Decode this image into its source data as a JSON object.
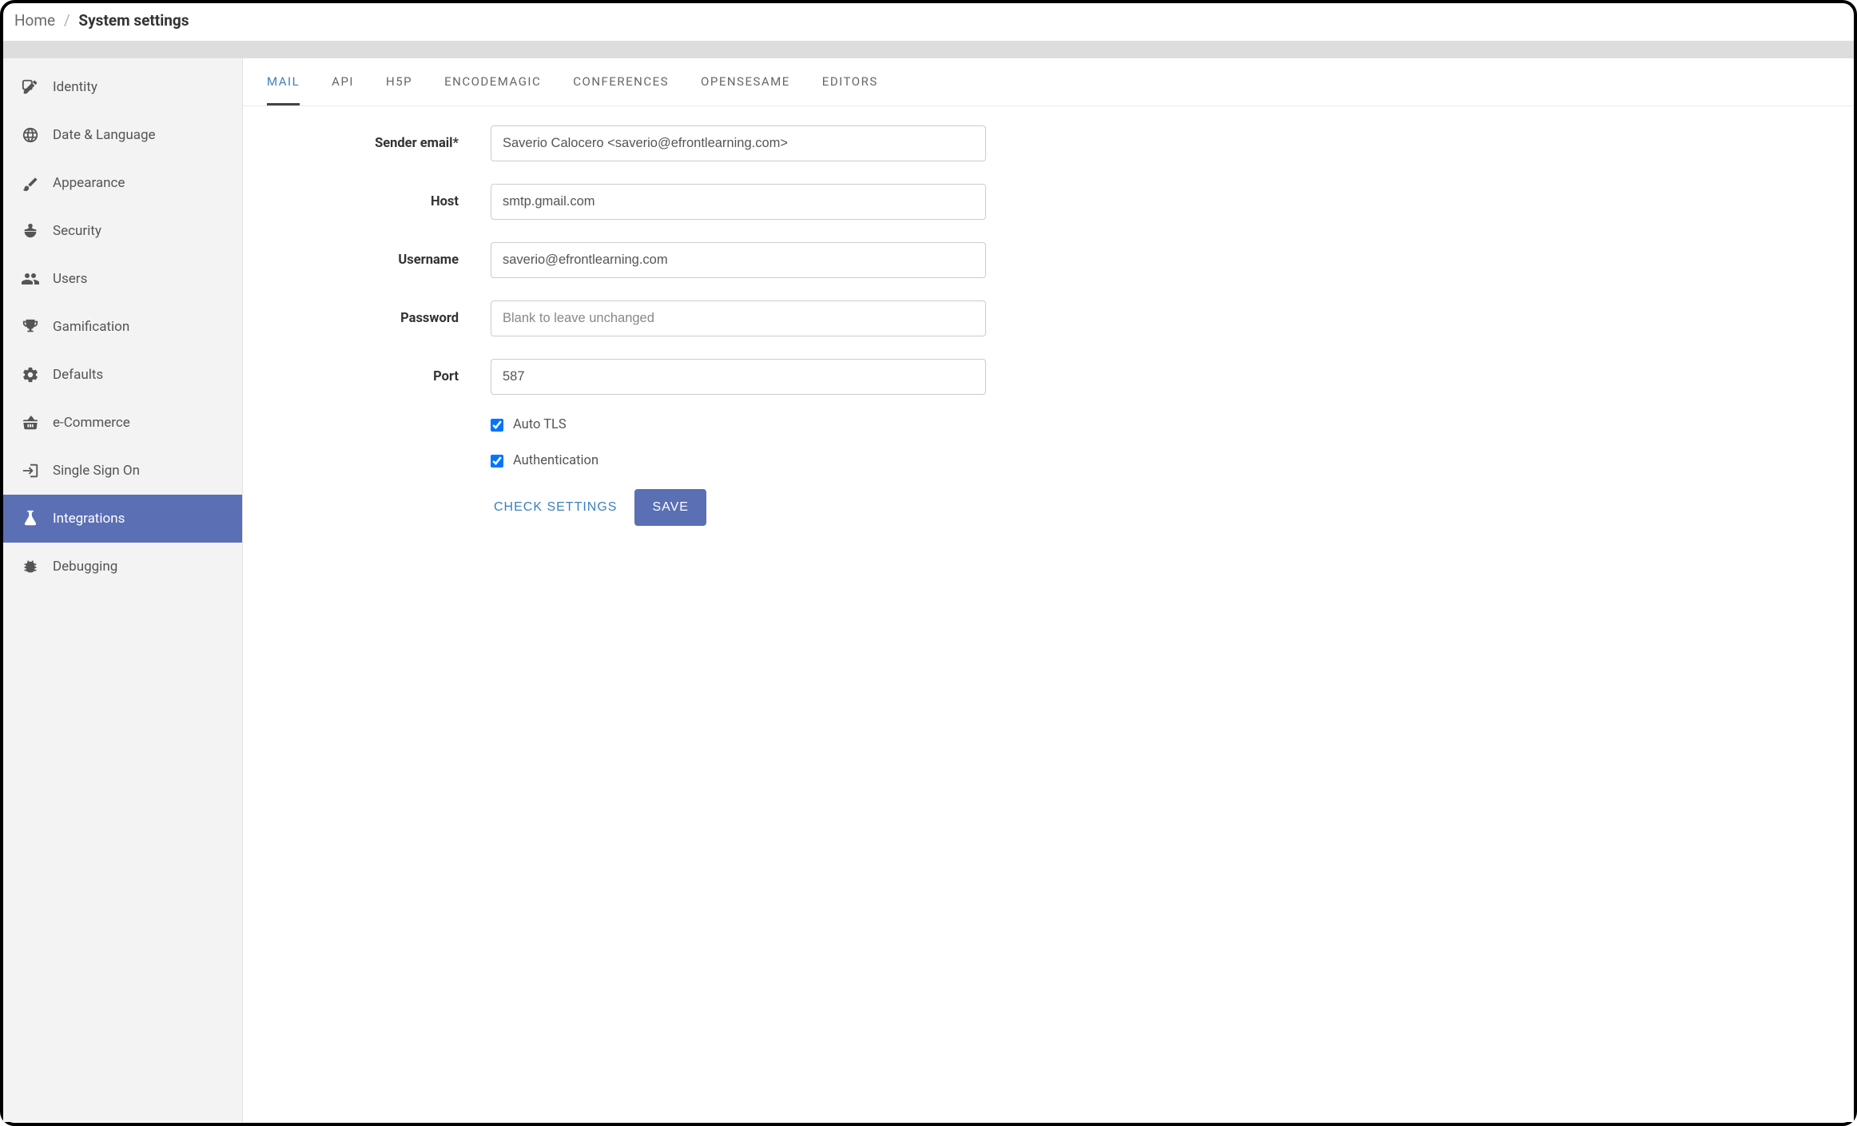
{
  "breadcrumb": {
    "home": "Home",
    "sep": "/",
    "current": "System settings"
  },
  "sidebar": {
    "items": [
      {
        "label": "Identity",
        "icon": "edit-icon"
      },
      {
        "label": "Date & Language",
        "icon": "globe-icon"
      },
      {
        "label": "Appearance",
        "icon": "brush-icon"
      },
      {
        "label": "Security",
        "icon": "agent-icon"
      },
      {
        "label": "Users",
        "icon": "users-icon"
      },
      {
        "label": "Gamification",
        "icon": "trophy-icon"
      },
      {
        "label": "Defaults",
        "icon": "gears-icon"
      },
      {
        "label": "e-Commerce",
        "icon": "basket-icon"
      },
      {
        "label": "Single Sign On",
        "icon": "signin-icon"
      },
      {
        "label": "Integrations",
        "icon": "flask-icon",
        "active": true
      },
      {
        "label": "Debugging",
        "icon": "bug-icon"
      }
    ]
  },
  "tabs": [
    {
      "label": "MAIL",
      "active": true
    },
    {
      "label": "API"
    },
    {
      "label": "H5P"
    },
    {
      "label": "ENCODEMAGIC"
    },
    {
      "label": "CONFERENCES"
    },
    {
      "label": "OPENSESAME"
    },
    {
      "label": "EDITORS"
    }
  ],
  "form": {
    "sender_email": {
      "label": "Sender email*",
      "value": "Saverio Calocero <saverio@efrontlearning.com>"
    },
    "host": {
      "label": "Host",
      "value": "smtp.gmail.com"
    },
    "username": {
      "label": "Username",
      "value": "saverio@efrontlearning.com"
    },
    "password": {
      "label": "Password",
      "value": "",
      "placeholder": "Blank to leave unchanged"
    },
    "port": {
      "label": "Port",
      "value": "587"
    },
    "auto_tls": {
      "label": "Auto TLS",
      "checked": true
    },
    "authentication": {
      "label": "Authentication",
      "checked": true
    },
    "check_settings": "CHECK SETTINGS",
    "save": "SAVE"
  }
}
